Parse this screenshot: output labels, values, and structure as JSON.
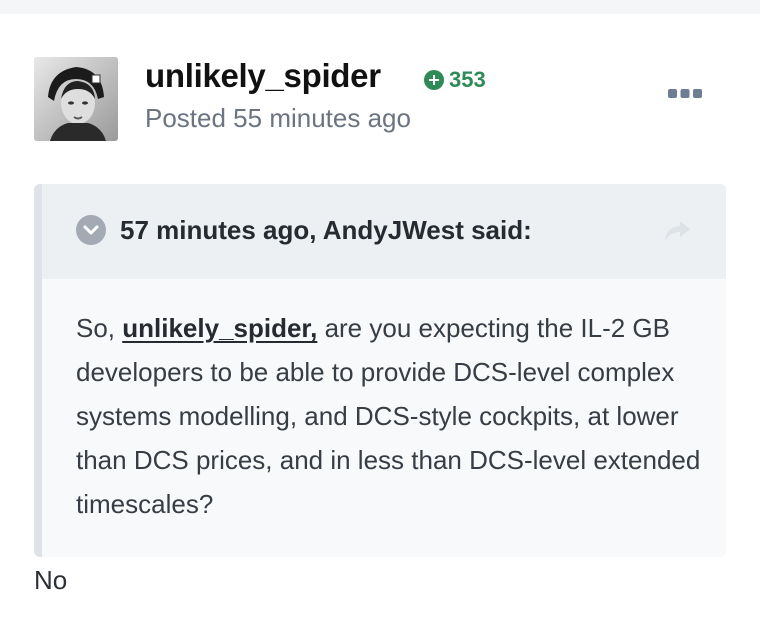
{
  "post": {
    "author": "unlikely_spider",
    "reputation": "353",
    "posted_label": "Posted 55 minutes ago",
    "reply_text": "No"
  },
  "quote": {
    "citation": "57 minutes ago, AndyJWest said:",
    "body_prefix": "So, ",
    "mention": "unlikely_spider,",
    "body_rest": " are you expecting the IL-2 GB developers to be able to provide DCS-level complex systems modelling, and DCS-style cockpits, at lower than DCS prices, and in less than DCS-level extended timescales?"
  },
  "icons": {
    "reputation": "plus-circle-icon",
    "menu": "ellipsis-icon",
    "toggle": "chevron-down-icon",
    "share": "share-arrow-icon"
  },
  "colors": {
    "reputation_green": "#2e8b57",
    "quote_bg": "#f7f9fb",
    "quote_header_bg": "#ecf0f3",
    "muted_text": "#6b7480"
  }
}
